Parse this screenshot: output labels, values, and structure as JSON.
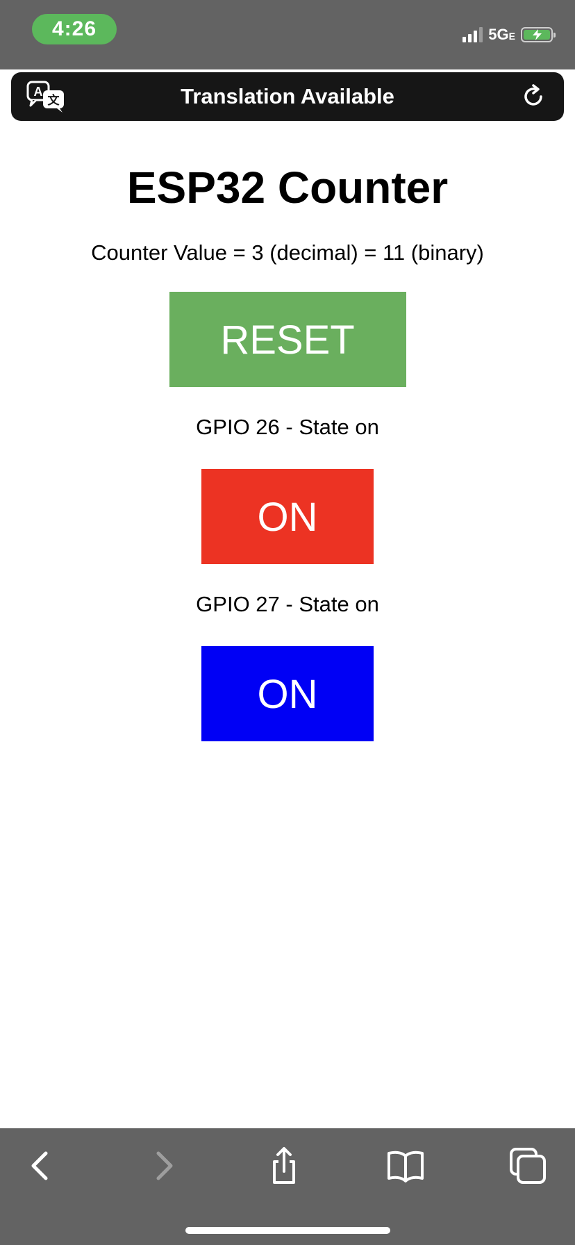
{
  "status_bar": {
    "time": "4:26",
    "network_main": "5G",
    "network_suffix": "E",
    "accent_color": "#5cb85c"
  },
  "translation_bar": {
    "title": "Translation Available",
    "left_icon": "translate-icon",
    "right_icon": "reload-icon"
  },
  "page": {
    "title": "ESP32 Counter",
    "counter_text": "Counter Value = 3 (decimal) = 11 (binary)",
    "reset_label": "RESET",
    "gpio": [
      {
        "label": "GPIO 26 - State on",
        "button_label": "ON",
        "color": "#ec3323"
      },
      {
        "label": "GPIO 27 - State on",
        "button_label": "ON",
        "color": "#0000f5"
      }
    ],
    "reset_color": "#6aaf5e"
  },
  "toolbar": {
    "items": [
      "back-icon",
      "forward-icon",
      "share-icon",
      "bookmarks-icon",
      "tabs-icon"
    ]
  }
}
